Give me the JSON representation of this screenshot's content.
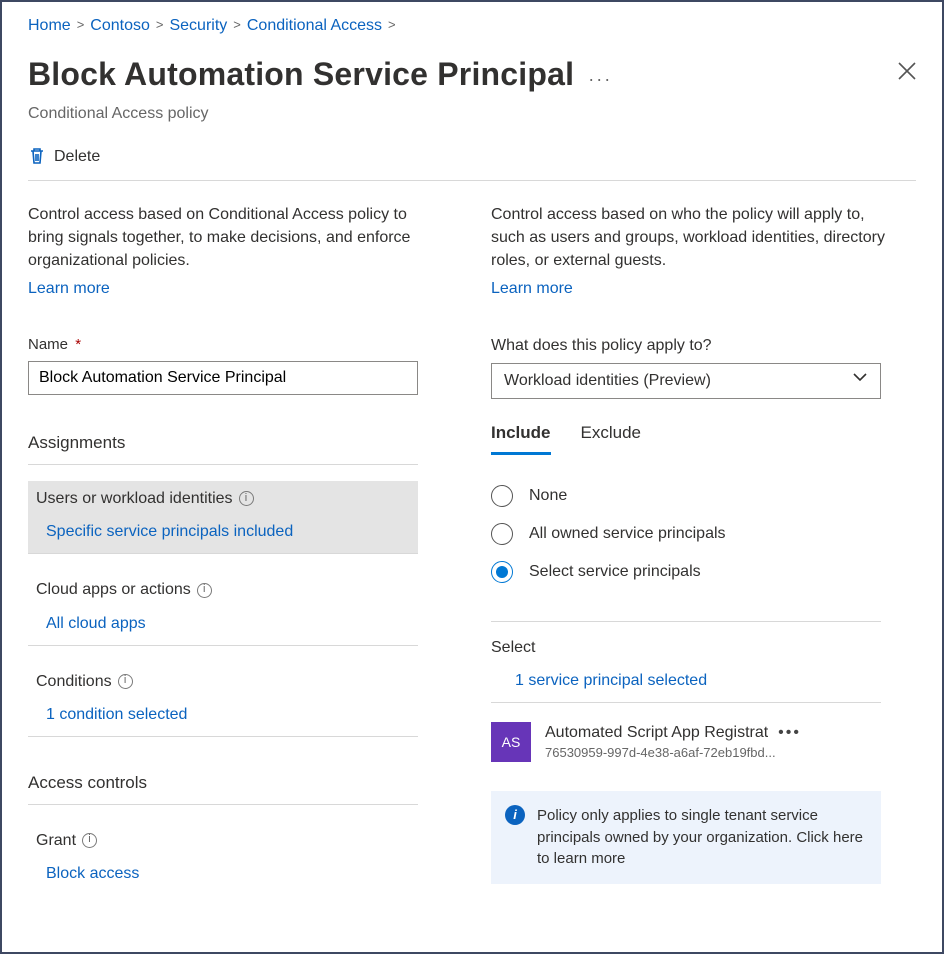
{
  "breadcrumb": [
    {
      "label": "Home"
    },
    {
      "label": "Contoso"
    },
    {
      "label": "Security"
    },
    {
      "label": "Conditional Access"
    }
  ],
  "title": "Block Automation Service Principal",
  "subtitle": "Conditional Access policy",
  "toolbar": {
    "delete_label": "Delete"
  },
  "left": {
    "desc": "Control access based on Conditional Access policy to bring signals together, to make decisions, and enforce organizational policies.",
    "learn_more": "Learn more",
    "name_label": "Name",
    "name_value": "Block Automation Service Principal",
    "assignments_title": "Assignments",
    "access_controls_title": "Access controls",
    "items": [
      {
        "label": "Users or workload identities",
        "detail": "Specific service principals included",
        "selected": true
      },
      {
        "label": "Cloud apps or actions",
        "detail": "All cloud apps",
        "selected": false
      },
      {
        "label": "Conditions",
        "detail": "1 condition selected",
        "selected": false
      }
    ],
    "grant": {
      "label": "Grant",
      "detail": "Block access"
    }
  },
  "right": {
    "desc": "Control access based on who the policy will apply to, such as users and groups, workload identities, directory roles, or external guests.",
    "learn_more": "Learn more",
    "apply_to_label": "What does this policy apply to?",
    "apply_to_value": "Workload identities (Preview)",
    "tabs": {
      "include": "Include",
      "exclude": "Exclude",
      "active": "include"
    },
    "radios": {
      "none": "None",
      "all": "All owned service principals",
      "select": "Select service principals",
      "selected": "select"
    },
    "select_label": "Select",
    "selected_count_text": "1 service principal selected",
    "principal": {
      "initials": "AS",
      "name": "Automated Script App Registrat",
      "id": "76530959-997d-4e38-a6af-72eb19fbd..."
    },
    "info_text": "Policy only applies to single tenant service principals owned by your organization. Click here to learn more"
  }
}
